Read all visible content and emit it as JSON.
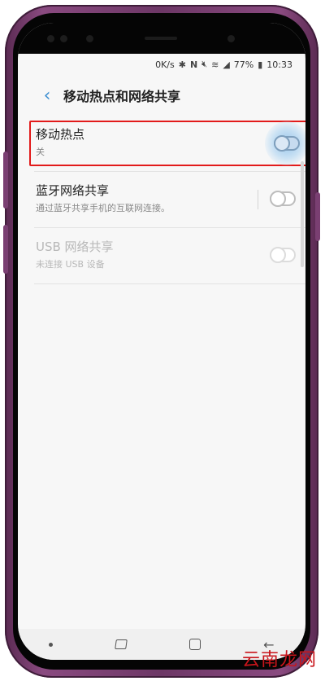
{
  "statusbar": {
    "speed": "0K/s",
    "bluetooth_icon": "bluetooth-icon",
    "nfc_icon": "nfc-icon",
    "mute_icon": "mute-icon",
    "wifi_icon": "wifi-icon",
    "signal_icon": "signal-icon",
    "battery": "77%",
    "battery_icon": "battery-icon",
    "time": "10:33"
  },
  "appbar": {
    "back_icon": "back-arrow-icon",
    "title": "移动热点和网络共享"
  },
  "settings": [
    {
      "label": "移动热点",
      "sub": "关",
      "enabled": true,
      "on": false,
      "highlighted": true
    },
    {
      "label": "蓝牙网络共享",
      "sub": "通过蓝牙共享手机的互联网连接。",
      "enabled": true,
      "on": false
    },
    {
      "label": "USB 网络共享",
      "sub": "未连接 USB 设备",
      "enabled": false,
      "on": false
    }
  ],
  "colors": {
    "accent": "#3d8fd1",
    "highlight": "#e21b1b",
    "phone_frame": "#7a3f72"
  },
  "watermark": "云南龙网"
}
